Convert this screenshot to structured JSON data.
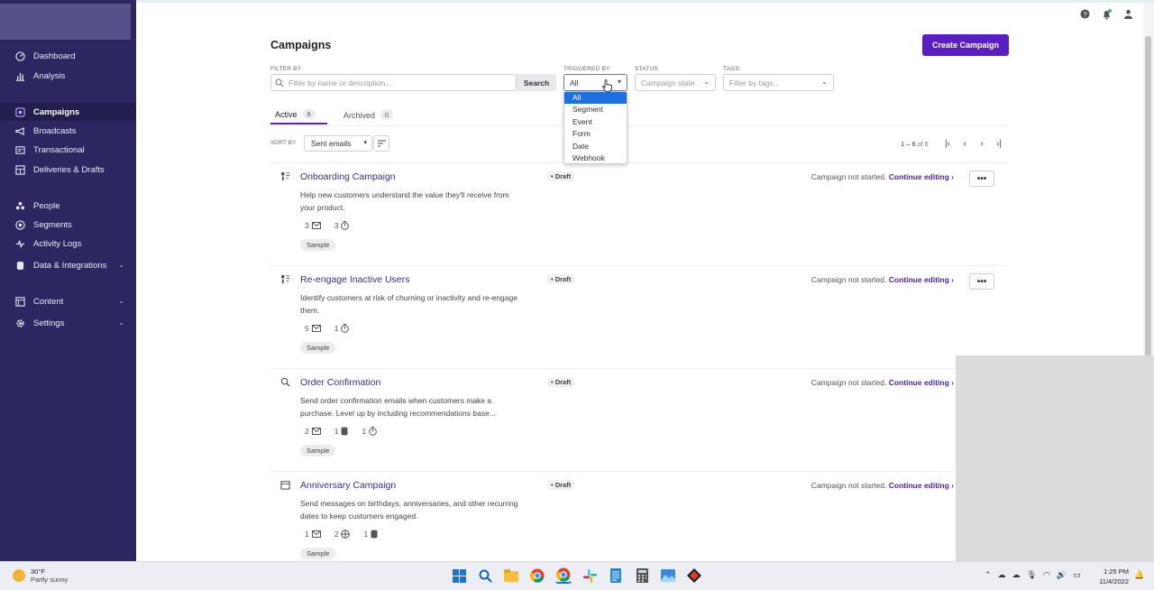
{
  "sidebar": {
    "items": [
      {
        "label": "Dashboard"
      },
      {
        "label": "Analysis"
      },
      {
        "label": "Campaigns"
      },
      {
        "label": "Broadcasts"
      },
      {
        "label": "Transactional"
      },
      {
        "label": "Deliveries & Drafts"
      },
      {
        "label": "People"
      },
      {
        "label": "Segments"
      },
      {
        "label": "Activity Logs"
      },
      {
        "label": "Data & Integrations"
      },
      {
        "label": "Content"
      },
      {
        "label": "Settings"
      }
    ]
  },
  "header": {
    "title": "Campaigns",
    "create_label": "Create Campaign"
  },
  "filters": {
    "filter_by_label": "FILTER BY",
    "filter_placeholder": "Filter by name or description...",
    "search_label": "Search",
    "triggered_by_label": "TRIGGERED BY",
    "triggered_by_value": "All",
    "status_label": "STATUS",
    "status_placeholder": "Campaign state",
    "tags_label": "TAGS",
    "tags_placeholder": "Filter by tags...",
    "trigger_options": [
      "All",
      "Segment",
      "Event",
      "Form",
      "Date",
      "Webhook"
    ]
  },
  "tabs": [
    {
      "label": "Active",
      "count": "6"
    },
    {
      "label": "Archived",
      "count": "0"
    }
  ],
  "sort": {
    "label": "SORT BY",
    "value": "Sent emails"
  },
  "pager": {
    "range": "1 – 6",
    "of": "of 6"
  },
  "campaigns": [
    {
      "title": "Onboarding Campaign",
      "desc": "Help new customers understand the value they'll receive from your product.",
      "stats": [
        "3",
        "3"
      ],
      "tag": "Sample",
      "draft": "Draft",
      "status": "Campaign not started.",
      "continue": "Continue editing ›",
      "more": "•••"
    },
    {
      "title": "Re-engage Inactive Users",
      "desc": "Identify customers at risk of churning or inactivity and re-engage them.",
      "stats": [
        "5",
        "1"
      ],
      "tag": "Sample",
      "draft": "Draft",
      "status": "Campaign not started.",
      "continue": "Continue editing ›",
      "more": "•••"
    },
    {
      "title": "Order Confirmation",
      "desc": "Send order confirmation emails when customers make a purchase. Level up by including recommendations base...",
      "stats": [
        "2",
        "1",
        "1"
      ],
      "tag": "Sample",
      "draft": "Draft",
      "status": "Campaign not started.",
      "continue": "Continue editing ›"
    },
    {
      "title": "Anniversary Campaign",
      "desc": "Send messages on birthdays, anniversaries, and other recurring dates to keep customers engaged.",
      "stats": [
        "1",
        "2",
        "1"
      ],
      "tag": "Sample",
      "draft": "Draft",
      "status": "Campaign not started.",
      "continue": "Continue editing ›"
    }
  ],
  "taskbar": {
    "temp": "30°F",
    "weather": "Partly sunny",
    "time": "1:25 PM",
    "date": "11/4/2022"
  },
  "colors": {
    "sidebar_bg": "#2c2761",
    "accent": "#5a1fc4",
    "link": "#3d2c8d",
    "dropdown_selected": "#1f6fe0"
  }
}
